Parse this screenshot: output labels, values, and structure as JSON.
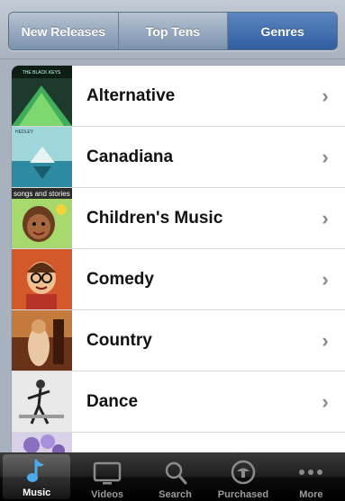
{
  "header": {
    "segments": [
      {
        "label": "New Releases",
        "selected": false
      },
      {
        "label": "Top Tens",
        "selected": false
      },
      {
        "label": "Genres",
        "selected": true
      }
    ]
  },
  "genres": {
    "items": [
      {
        "label": "Alternative",
        "art_lettering": "THE BLACK KEYS"
      },
      {
        "label": "Canadiana",
        "art_lettering": "HEDLEY"
      },
      {
        "label": "Children's Music",
        "art_lettering": "songs and stories"
      },
      {
        "label": "Comedy",
        "art_lettering": ""
      },
      {
        "label": "Country",
        "art_lettering": ""
      },
      {
        "label": "Dance",
        "art_lettering": ""
      },
      {
        "label": "",
        "art_lettering": ""
      }
    ],
    "chevron": "›"
  },
  "tabbar": {
    "tabs": [
      {
        "label": "Music",
        "icon": "music-note-icon",
        "active": true
      },
      {
        "label": "Videos",
        "icon": "tv-icon",
        "active": false
      },
      {
        "label": "Search",
        "icon": "magnifier-icon",
        "active": false
      },
      {
        "label": "Purchased",
        "icon": "download-icon",
        "active": false
      },
      {
        "label": "More",
        "icon": "more-dots-icon",
        "active": false
      }
    ]
  },
  "colors": {
    "selected_segment": "#3a68ac",
    "music_icon": "#4fa9ee"
  }
}
